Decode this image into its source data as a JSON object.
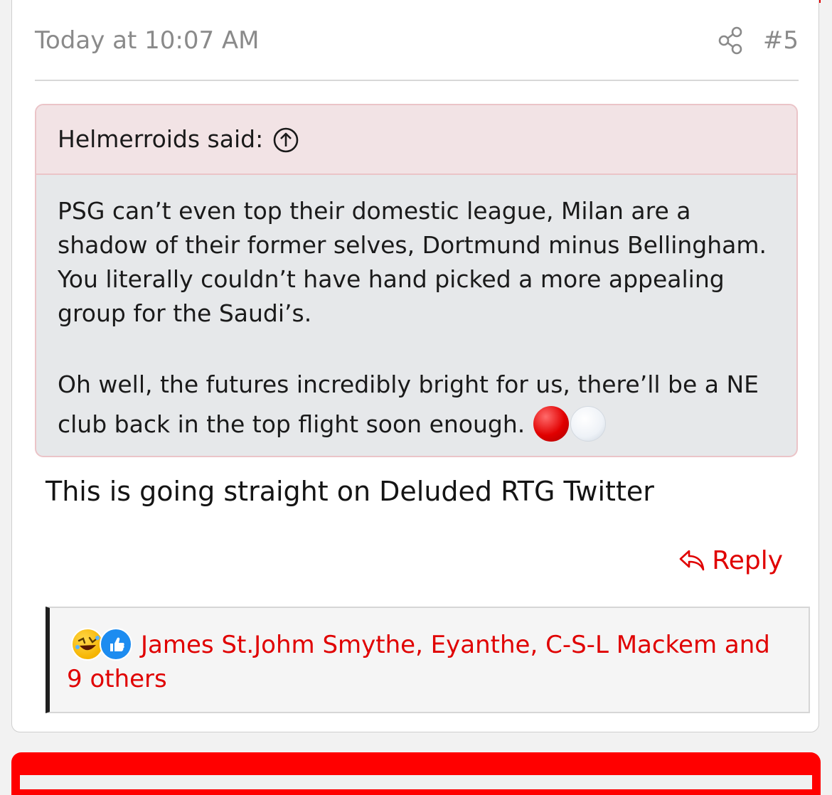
{
  "post": {
    "timestamp": "Today at 10:07 AM",
    "post_number": "#5",
    "share_icon": "share-icon",
    "text": "This is going straight on Deluded RTG Twitter"
  },
  "quote": {
    "author_label": "Helmerroids said:",
    "jump_icon": "arrow-up-circle-icon",
    "paragraph1": "PSG can’t even top their domestic league, Milan are a shadow of their former selves, Dortmund minus Bellingham. You literally couldn’t have hand picked a more appealing group for the Saudi’s.",
    "paragraph2": "Oh well, the futures incredibly bright for us, there’ll be a NE club back in the top flight soon enough.",
    "emoji": "red-circle white-circle"
  },
  "actions": {
    "reply_label": "Reply",
    "reply_icon": "reply-arrow-icon"
  },
  "reactions": {
    "icons": [
      "rofl-emoji-icon",
      "thumbs-up-icon"
    ],
    "text": "James St.Johm Smythe, Eyanthe, C-S-L Mackem and 9 others"
  },
  "colors": {
    "accent": "#e00000",
    "quote_header_bg": "#f2e3e5",
    "quote_body_bg": "#e6e8ea",
    "quote_border": "#ebc4c8",
    "meta_text": "#8a8a8a"
  }
}
